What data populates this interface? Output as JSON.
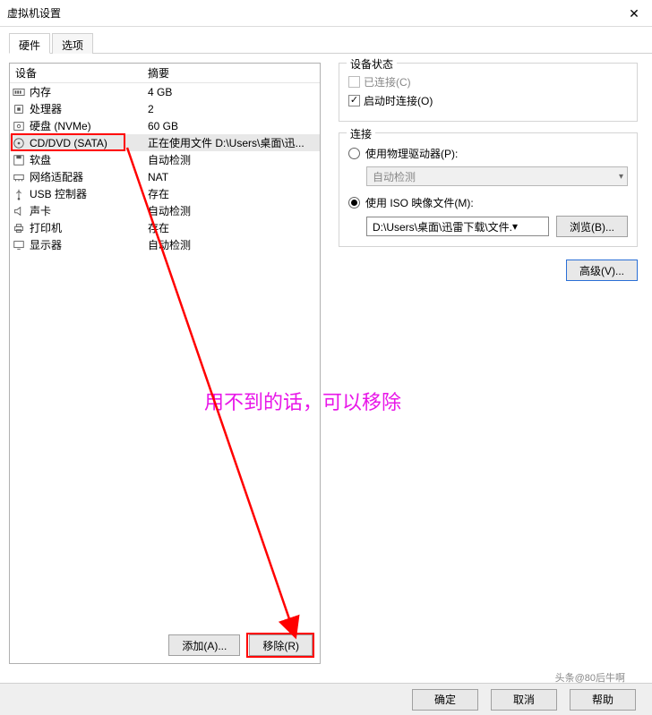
{
  "window": {
    "title": "虚拟机设置"
  },
  "tabs": {
    "hardware": "硬件",
    "options": "选项"
  },
  "table": {
    "device_header": "设备",
    "summary_header": "摘要"
  },
  "devices": [
    {
      "icon": "memory",
      "name": "内存",
      "summary": "4 GB"
    },
    {
      "icon": "cpu",
      "name": "处理器",
      "summary": "2"
    },
    {
      "icon": "disk",
      "name": "硬盘 (NVMe)",
      "summary": "60 GB"
    },
    {
      "icon": "disc",
      "name": "CD/DVD (SATA)",
      "summary": "正在使用文件 D:\\Users\\桌面\\迅..."
    },
    {
      "icon": "floppy",
      "name": "软盘",
      "summary": "自动检测"
    },
    {
      "icon": "nic",
      "name": "网络适配器",
      "summary": "NAT"
    },
    {
      "icon": "usb",
      "name": "USB 控制器",
      "summary": "存在"
    },
    {
      "icon": "sound",
      "name": "声卡",
      "summary": "自动检测"
    },
    {
      "icon": "printer",
      "name": "打印机",
      "summary": "存在"
    },
    {
      "icon": "display",
      "name": "显示器",
      "summary": "自动检测"
    }
  ],
  "left_buttons": {
    "add": "添加(A)...",
    "remove": "移除(R)"
  },
  "status_group": {
    "title": "设备状态",
    "connected": "已连接(C)",
    "connect_on_power": "启动时连接(O)"
  },
  "connection_group": {
    "title": "连接",
    "use_physical": "使用物理驱动器(P):",
    "auto_detect": "自动检测",
    "use_iso": "使用 ISO 映像文件(M):",
    "iso_path": "D:\\Users\\桌面\\迅雷下载\\文件.",
    "browse": "浏览(B)..."
  },
  "advanced": "高级(V)...",
  "bottom": {
    "ok": "确定",
    "cancel": "取消",
    "help": "帮助"
  },
  "annotation": "用不到的话，可以移除",
  "watermark": "头条@80后牛啊"
}
